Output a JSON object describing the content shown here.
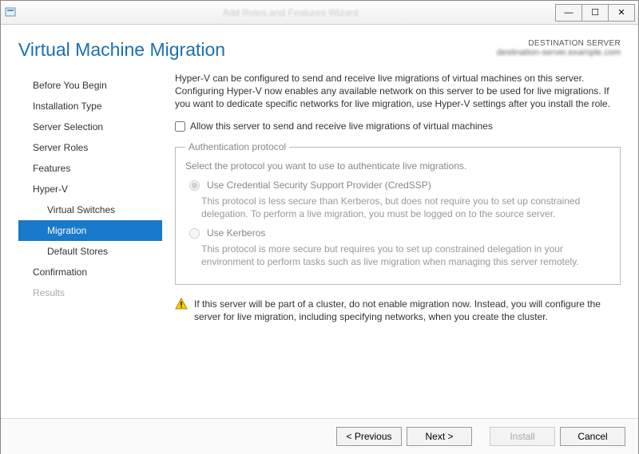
{
  "window": {
    "title": "Add Roles and Features Wizard",
    "minimize_glyph": "—",
    "maximize_glyph": "☐",
    "close_glyph": "✕"
  },
  "header": {
    "title": "Virtual Machine Migration",
    "destination_label": "DESTINATION SERVER",
    "destination_value": "destination-server.example.com"
  },
  "nav": {
    "items": [
      {
        "label": "Before You Begin",
        "sub": false,
        "selected": false,
        "disabled": false
      },
      {
        "label": "Installation Type",
        "sub": false,
        "selected": false,
        "disabled": false
      },
      {
        "label": "Server Selection",
        "sub": false,
        "selected": false,
        "disabled": false
      },
      {
        "label": "Server Roles",
        "sub": false,
        "selected": false,
        "disabled": false
      },
      {
        "label": "Features",
        "sub": false,
        "selected": false,
        "disabled": false
      },
      {
        "label": "Hyper-V",
        "sub": false,
        "selected": false,
        "disabled": false
      },
      {
        "label": "Virtual Switches",
        "sub": true,
        "selected": false,
        "disabled": false
      },
      {
        "label": "Migration",
        "sub": true,
        "selected": true,
        "disabled": false
      },
      {
        "label": "Default Stores",
        "sub": true,
        "selected": false,
        "disabled": false
      },
      {
        "label": "Confirmation",
        "sub": false,
        "selected": false,
        "disabled": false
      },
      {
        "label": "Results",
        "sub": false,
        "selected": false,
        "disabled": true
      }
    ]
  },
  "content": {
    "intro": "Hyper-V can be configured to send and receive live migrations of virtual machines on this server. Configuring Hyper-V now enables any available network on this server to be used for live migrations. If you want to dedicate specific networks for live migration, use Hyper-V settings after you install the role.",
    "allow_checkbox_label": "Allow this server to send and receive live migrations of virtual machines",
    "allow_checkbox_checked": false,
    "auth": {
      "legend": "Authentication protocol",
      "prompt": "Select the protocol you want to use to authenticate live migrations.",
      "options": [
        {
          "label": "Use Credential Security Support Provider (CredSSP)",
          "desc": "This protocol is less secure than Kerberos, but does not require you to set up constrained delegation. To perform a live migration, you must be logged on to the source server.",
          "checked": true
        },
        {
          "label": "Use Kerberos",
          "desc": "This protocol is more secure but requires you to set up constrained delegation in your environment to perform tasks such as live migration when managing this server remotely.",
          "checked": false
        }
      ]
    },
    "warning": "If this server will be part of a cluster, do not enable migration now. Instead, you will configure the server for live migration, including specifying networks, when you create the cluster."
  },
  "footer": {
    "previous": "< Previous",
    "next": "Next >",
    "install": "Install",
    "cancel": "Cancel",
    "install_enabled": false
  }
}
